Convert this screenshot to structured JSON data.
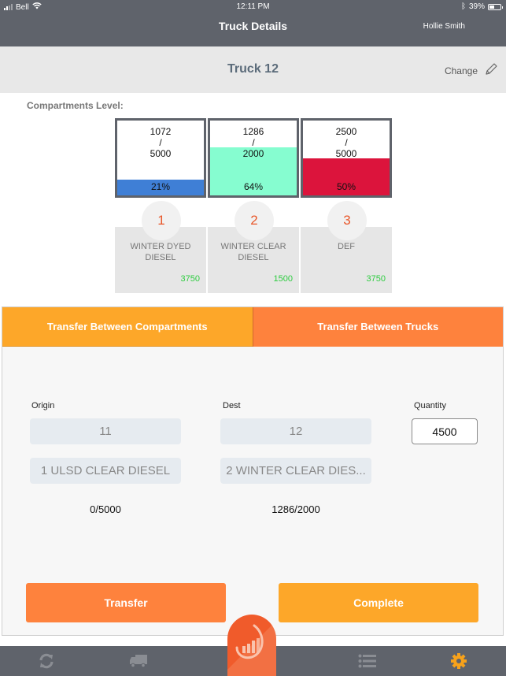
{
  "status_bar": {
    "carrier": "Bell",
    "time": "12:11 PM",
    "battery": "39%"
  },
  "nav": {
    "title": "Truck Details",
    "user": "Hollie Smith"
  },
  "truck": {
    "name": "Truck 12",
    "change_label": "Change"
  },
  "compartments_label": "Compartments Level:",
  "compartments": [
    {
      "number": "1",
      "current": "1072",
      "separator": "/",
      "capacity": "5000",
      "percent_label": "21%",
      "fill_fraction": 0.21,
      "fill_color": "#3f7fd6",
      "product": "WINTER DYED DIESEL",
      "product_line1": "WINTER DYED",
      "product_line2": "DIESEL",
      "quantity": "3750"
    },
    {
      "number": "2",
      "current": "1286",
      "separator": "/",
      "capacity": "2000",
      "percent_label": "64%",
      "fill_fraction": 0.64,
      "fill_color": "#86fdd0",
      "product": "WINTER CLEAR DIESEL",
      "product_line1": "WINTER CLEAR",
      "product_line2": "DIESEL",
      "quantity": "1500"
    },
    {
      "number": "3",
      "current": "2500",
      "separator": "/",
      "capacity": "5000",
      "percent_label": "50%",
      "fill_fraction": 0.5,
      "fill_color": "#dc143c",
      "product": "DEF",
      "product_line1": "DEF",
      "product_line2": "",
      "quantity": "3750"
    }
  ],
  "transfer": {
    "tabs": [
      {
        "label": "Transfer Between Compartments",
        "active": true
      },
      {
        "label": "Transfer Between Trucks",
        "active": false
      }
    ],
    "origin": {
      "label": "Origin",
      "truck": "11",
      "compartment": "1 ULSD CLEAR DIESEL",
      "level": "0/5000"
    },
    "dest": {
      "label": "Dest",
      "truck": "12",
      "compartment": "2 WINTER CLEAR DIES...",
      "level": "1286/2000"
    },
    "quantity": {
      "label": "Quantity",
      "value": "4500"
    },
    "transfer_button": "Transfer",
    "complete_button": "Complete"
  },
  "tabbar": {
    "items": [
      {
        "icon": "sync-icon"
      },
      {
        "icon": "truck-icon"
      },
      {
        "icon": "gauge-logo-icon"
      },
      {
        "icon": "list-icon"
      },
      {
        "icon": "gear-icon",
        "active": true
      }
    ],
    "active_color": "#f7a21b",
    "inactive_color": "#8a8d93"
  },
  "colors": {
    "nav_bg": "#5f636b",
    "accent_orange": "#fe823d",
    "accent_amber": "#fda729",
    "quantity_green": "#2ecc40",
    "number_red": "#e8572a"
  }
}
